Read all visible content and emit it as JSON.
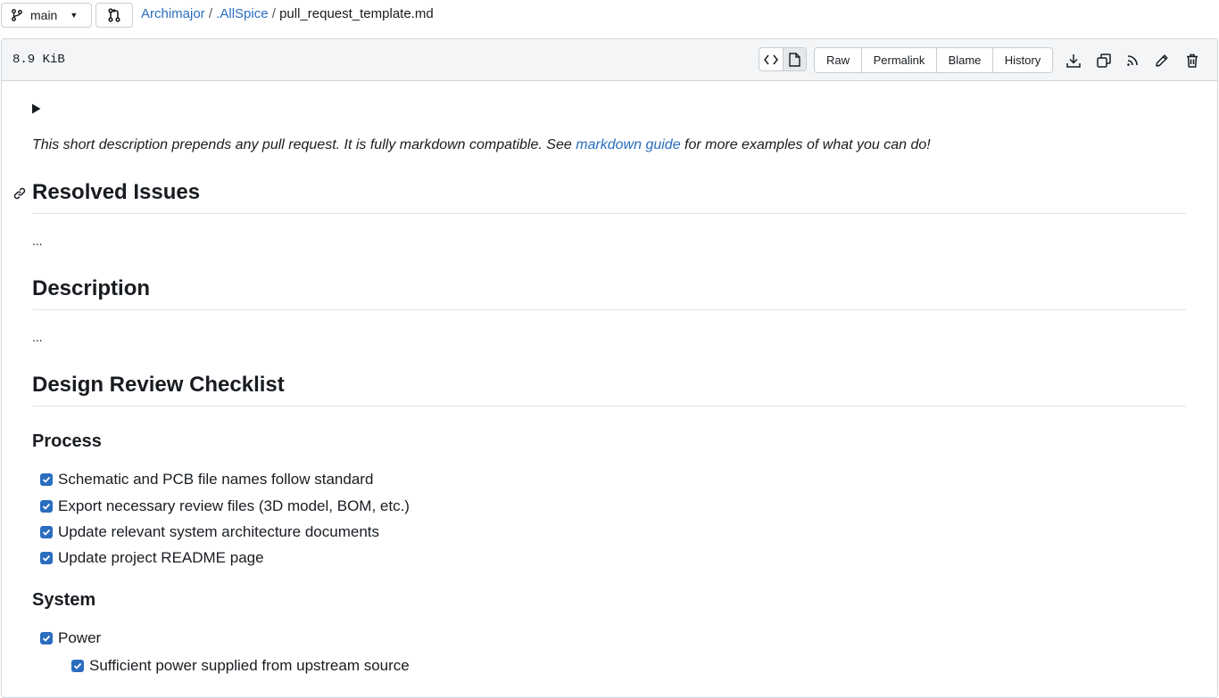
{
  "branch": {
    "label": "main"
  },
  "breadcrumb": {
    "owner": "Archimajor",
    "repo": ".AllSpice",
    "separator": "/",
    "file": "pull_request_template.md"
  },
  "file_header": {
    "size": "8.9 KiB",
    "buttons": {
      "raw": "Raw",
      "permalink": "Permalink",
      "blame": "Blame",
      "history": "History"
    }
  },
  "content": {
    "intro_before_link": "This short description prepends any pull request. It is fully markdown compatible. See ",
    "intro_link": "markdown guide",
    "intro_after_link": " for more examples of what you can do!",
    "sections": {
      "resolved_issues": {
        "heading": "Resolved Issues",
        "body": "..."
      },
      "description": {
        "heading": "Description",
        "body": "..."
      },
      "checklist": {
        "heading": "Design Review Checklist"
      }
    },
    "process": {
      "heading": "Process",
      "items": [
        "Schematic and PCB file names follow standard",
        "Export necessary review files (3D model, BOM, etc.)",
        "Update relevant system architecture documents",
        "Update project README page"
      ]
    },
    "system": {
      "heading": "System",
      "items": [
        "Power",
        "Sufficient power supplied from upstream source"
      ]
    }
  },
  "colors": {
    "link": "#2a6dbf",
    "checkbox": "#2a6dbf",
    "header_bg": "#f3f5f7",
    "border": "#d0d7de"
  }
}
